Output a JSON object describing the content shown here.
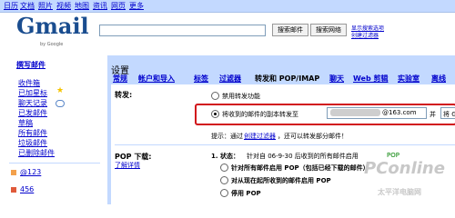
{
  "top_nav": [
    "日历",
    "文档",
    "照片",
    "视频",
    "地图",
    "资讯",
    "网页",
    "更多"
  ],
  "top_nav_current": "网页",
  "logo": {
    "text": "Gmail",
    "byline": "by Google"
  },
  "search": {
    "button_mail": "搜索邮件",
    "button_web": "搜索网络",
    "link_1": "显示搜索选项",
    "link_2": "创建过滤器"
  },
  "sidebar": {
    "compose": "撰写邮件",
    "items": [
      "收件箱",
      "已加星标",
      "聊天记录",
      "已发邮件",
      "草稿",
      "所有邮件",
      "垃圾邮件",
      "已删除邮件"
    ],
    "accounts": [
      "@123",
      "456"
    ]
  },
  "settings": {
    "title": "设置",
    "tabs": [
      "常规",
      "帐户和导入",
      "标签",
      "过滤器",
      "转发和 POP/IMAP",
      "聊天",
      "Web 剪辑",
      "实验室",
      "离线"
    ],
    "active_tab_index": 4,
    "forwarding_label": "转发:",
    "option_disable": "禁用转发功能",
    "option_forward": "将收到的邮件的副本转发至",
    "forward_domain": "@163.com",
    "and_text": "并",
    "gmail_select": "将 Gmail 副",
    "tip_prefix": "提示：通过",
    "tip_link": "创建过滤器",
    "tip_suffix": "，还可以转发部分邮件！",
    "pop_label": "POP 下载:",
    "pop_learn": "了解详情",
    "pop_status_prefix": "1. 状态：",
    "pop_status_mid": "针对自 06-9-30 后收到的所有邮件启用",
    "pop_status_pop": "POP",
    "pop_opt1": "针对所有邮件启用 POP（包括已经下载的邮件）",
    "pop_opt2": "对从现在起所收到的邮件启用 POP",
    "pop_opt3": "停用 POP"
  },
  "watermark": {
    "brand": "PConline",
    "sub": "太平洋电脑网"
  },
  "colors": {
    "accent": "#c3d9ff",
    "highlight": "#d1141b",
    "link": "#0000cc"
  }
}
